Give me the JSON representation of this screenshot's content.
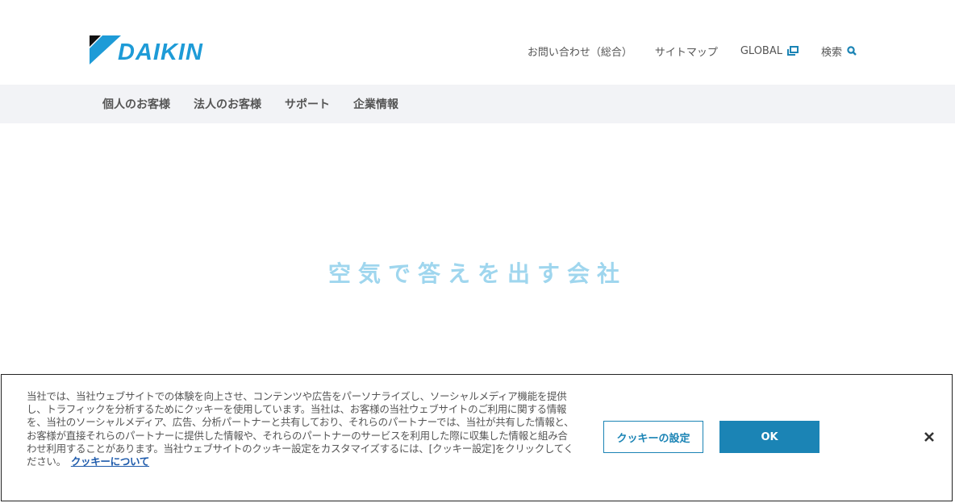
{
  "header": {
    "logo_text": "DAIKIN",
    "util_nav": [
      {
        "label": "お問い合わせ（総合）"
      },
      {
        "label": "サイトマップ"
      },
      {
        "label": "GLOBAL",
        "icon": "external-window-icon"
      },
      {
        "label": "検索",
        "icon": "search-icon"
      }
    ]
  },
  "global_nav": {
    "items": [
      {
        "label": "個人のお客様"
      },
      {
        "label": "法人のお客様"
      },
      {
        "label": "サポート"
      },
      {
        "label": "企業情報"
      }
    ]
  },
  "hero": {
    "tagline": "空気で答えを出す会社"
  },
  "cookie_banner": {
    "text": "当社では、当社ウェブサイトでの体験を向上させ、コンテンツや広告をパーソナライズし、ソーシャルメディア機能を提供し、トラフィックを分析するためにクッキーを使用しています。当社は、お客様の当社ウェブサイトのご利用に関する情報を、当社のソーシャルメディア、広告、分析パートナーと共有しており、それらのパートナーでは、当社が共有した情報と、お客様が直接それらのパートナーに提供した情報や、それらのパートナーのサービスを利用した際に収集した情報と組み合わせ利用することがあります。当社ウェブサイトのクッキー設定をカスタマイズするには、[クッキー設定]をクリックしてください。",
    "link_label": "クッキーについて",
    "settings_button": "クッキーの設定",
    "ok_button": "OK",
    "close_icon": "close-icon"
  },
  "colors": {
    "brand_blue": "#1b84b5",
    "logo_blue": "#1e9bd7",
    "tagline": "#9fd6ee",
    "nav_bg": "#f2f3f6"
  }
}
